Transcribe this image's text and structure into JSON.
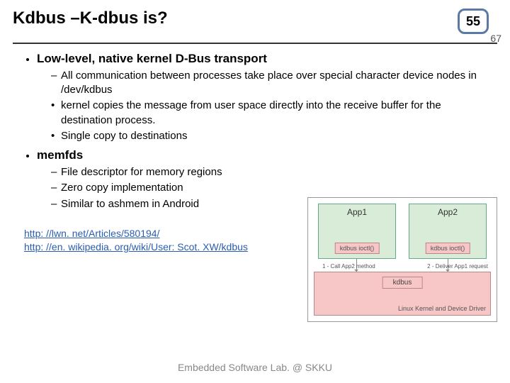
{
  "header": {
    "title": "Kdbus –K-dbus is?",
    "page_current": "55",
    "page_total": "67"
  },
  "bullets": {
    "b1": {
      "head": "Low-level, native kernel D-Bus transport",
      "s1": "All communication between processes take place over special character device nodes in /dev/kdbus",
      "s2": "kernel copies the message from user space directly into the receive buffer for the destination process.",
      "s3": "Single copy to destinations"
    },
    "b2": {
      "head": "memfds",
      "s1": "File descriptor for memory regions",
      "s2": "Zero copy implementation",
      "s3": "Similar to ashmem in Android"
    }
  },
  "links": {
    "l1": "http: //lwn. net/Articles/580194/",
    "l2": "http: //en. wikipedia. org/wiki/User: Scot. XW/kdbus"
  },
  "diagram": {
    "app1": "App1",
    "app2": "App2",
    "ioctl": "kdbus ioctl()",
    "kdbus": "kdbus",
    "kernel": "Linux Kernel and Device Driver",
    "arrow1": "1 - Call App2 method",
    "arrow2": "2 - Deliver App1 request"
  },
  "footer": "Embedded Software Lab. @ SKKU"
}
